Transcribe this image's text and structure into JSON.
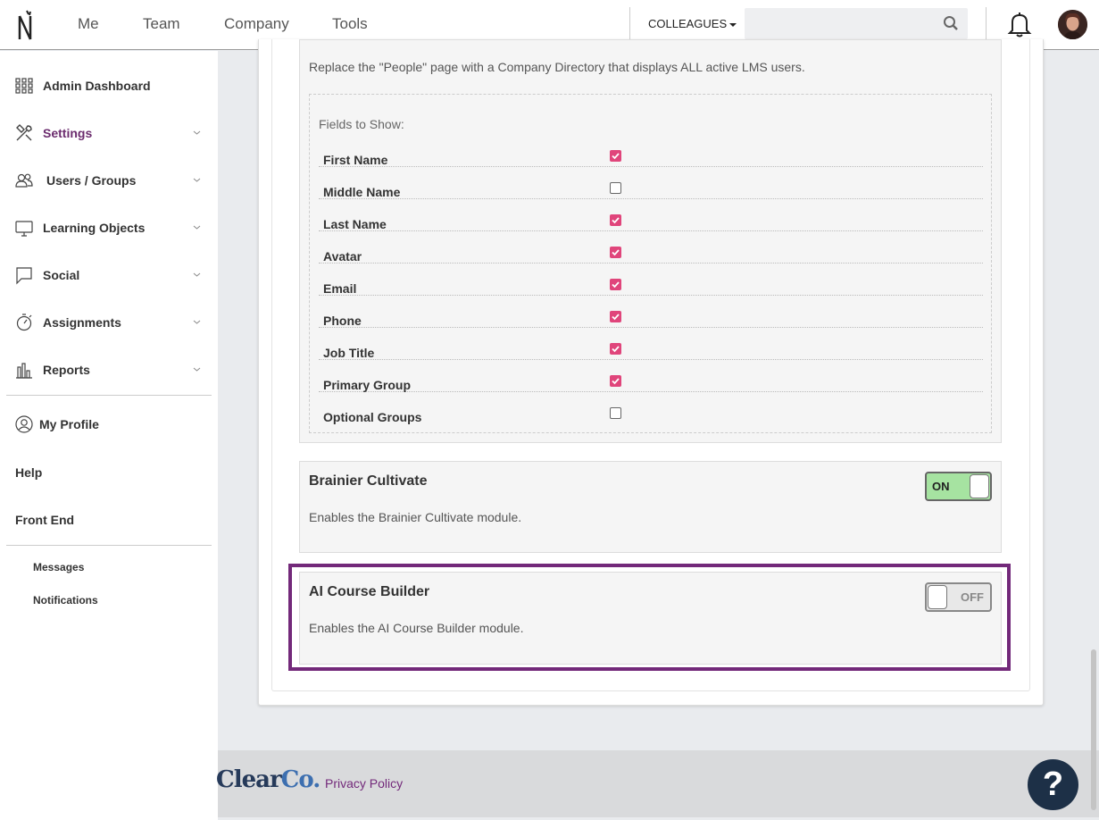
{
  "nav": {
    "items": [
      "Me",
      "Team",
      "Company",
      "Tools"
    ],
    "colleagues_label": "COLLEAGUES",
    "search_placeholder": ""
  },
  "sidebar": {
    "items": [
      {
        "label": "Admin Dashboard",
        "icon": "grid-icon"
      },
      {
        "label": "Settings",
        "icon": "tools-icon",
        "active": true
      },
      {
        "label": "Users / Groups",
        "icon": "users-icon"
      },
      {
        "label": "Learning Objects",
        "icon": "monitor-icon"
      },
      {
        "label": "Social",
        "icon": "chat-icon"
      },
      {
        "label": "Assignments",
        "icon": "timer-icon"
      },
      {
        "label": "Reports",
        "icon": "bar-chart-icon"
      }
    ],
    "my_profile": "My Profile",
    "help": "Help",
    "front_end": "Front End",
    "messages": "Messages",
    "notifications": "Notifications"
  },
  "directory": {
    "description": "Replace the \"People\" page with a Company Directory that displays ALL active LMS users.",
    "fields_title": "Fields to Show:",
    "fields": [
      {
        "label": "First Name",
        "checked": true
      },
      {
        "label": "Middle Name",
        "checked": false
      },
      {
        "label": "Last Name",
        "checked": true
      },
      {
        "label": "Avatar",
        "checked": true
      },
      {
        "label": "Email",
        "checked": true
      },
      {
        "label": "Phone",
        "checked": true
      },
      {
        "label": "Job Title",
        "checked": true
      },
      {
        "label": "Primary Group",
        "checked": true
      },
      {
        "label": "Optional Groups",
        "checked": false
      }
    ]
  },
  "cultivate": {
    "title": "Brainier Cultivate",
    "description": "Enables the Brainier Cultivate module.",
    "toggle": "ON"
  },
  "ai_builder": {
    "title": "AI Course Builder",
    "description": "Enables the AI Course Builder module.",
    "toggle": "OFF"
  },
  "footer": {
    "brand_main": "Clear",
    "brand_co": "Co.",
    "privacy": "Privacy Policy"
  },
  "help_button": "?",
  "colors": {
    "accent": "#73297a",
    "checkbox": "#e0457b",
    "toggle_on": "#a6e3a1",
    "help_bg": "#1d3047"
  }
}
